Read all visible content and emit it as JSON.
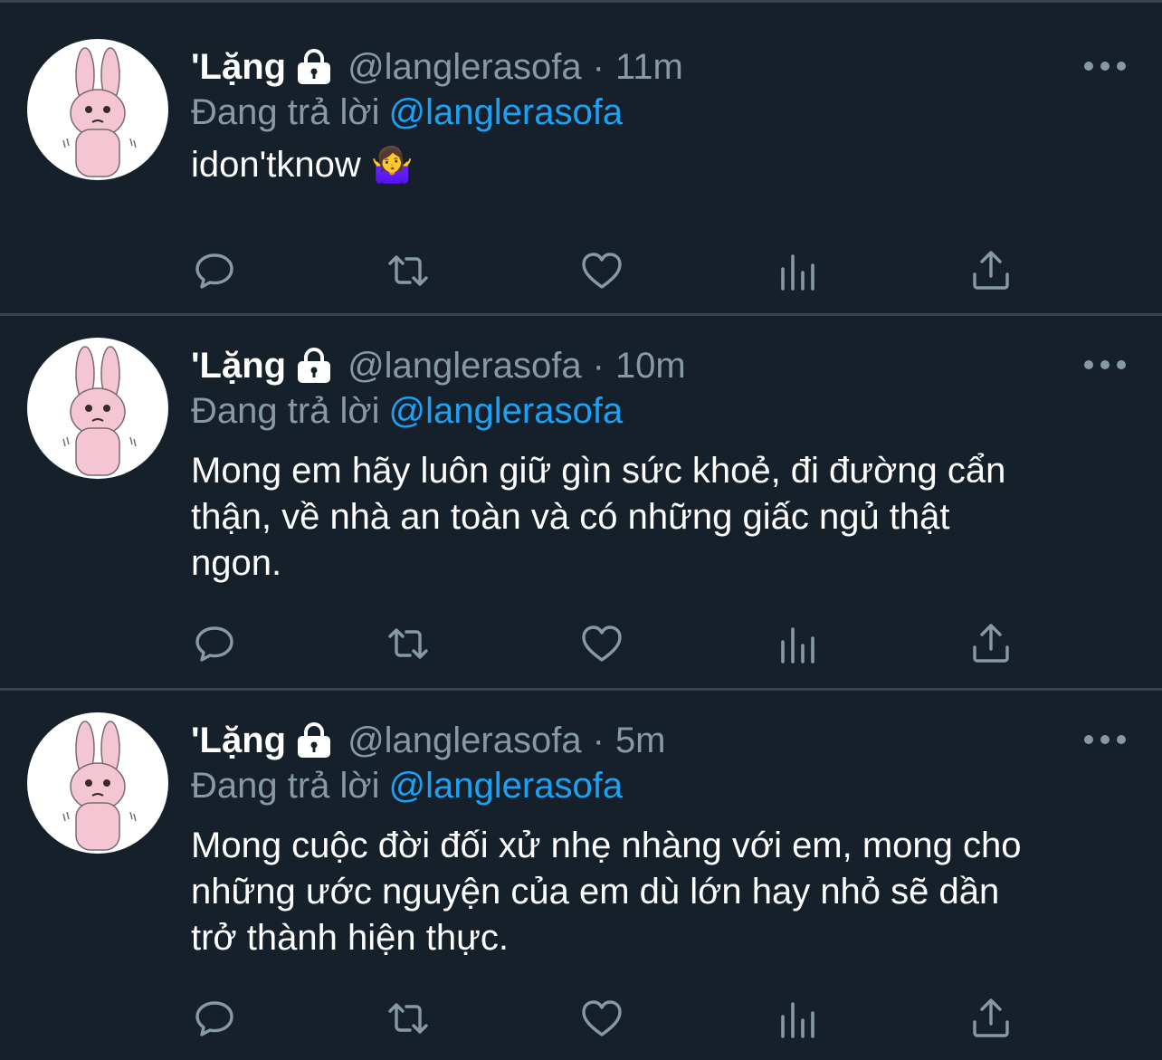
{
  "tweets": [
    {
      "display_name": "'Lặng",
      "handle": "@langlerasofa",
      "separator": "·",
      "time": "11m",
      "reply_prefix": "Đang trả lời",
      "reply_to": "@langlerasofa",
      "text": "idon'tknow",
      "emoji": "🤷‍♀️"
    },
    {
      "display_name": "'Lặng",
      "handle": "@langlerasofa",
      "separator": "·",
      "time": "10m",
      "reply_prefix": "Đang trả lời",
      "reply_to": "@langlerasofa",
      "text_lines": [
        "Mong em hãy luôn giữ gìn sức khoẻ, đi đường cẩn",
        "thận, về nhà an toàn và có những giấc ngủ thật",
        "ngon."
      ]
    },
    {
      "display_name": "'Lặng",
      "handle": "@langlerasofa",
      "separator": "·",
      "time": "5m",
      "reply_prefix": "Đang trả lời",
      "reply_to": "@langlerasofa",
      "text_lines": [
        "Mong cuộc đời đối xử nhẹ nhàng với em, mong cho",
        "những ước nguyện của em dù lớn hay nhỏ sẽ dần",
        "trở thành hiện thực."
      ]
    }
  ],
  "icons": {
    "avatar": "pink-bunny-avatar",
    "lock": "lock-icon",
    "more": "more-options-icon",
    "reply": "reply-icon",
    "retweet": "retweet-icon",
    "like": "like-heart-icon",
    "analytics": "analytics-icon",
    "share": "share-icon"
  },
  "colors": {
    "background": "#15202b",
    "divider": "#38444d",
    "primary_text": "#ffffff",
    "secondary_text": "#8899a6",
    "accent": "#1da1f2",
    "avatar_bunny": "#f4c6d3"
  }
}
